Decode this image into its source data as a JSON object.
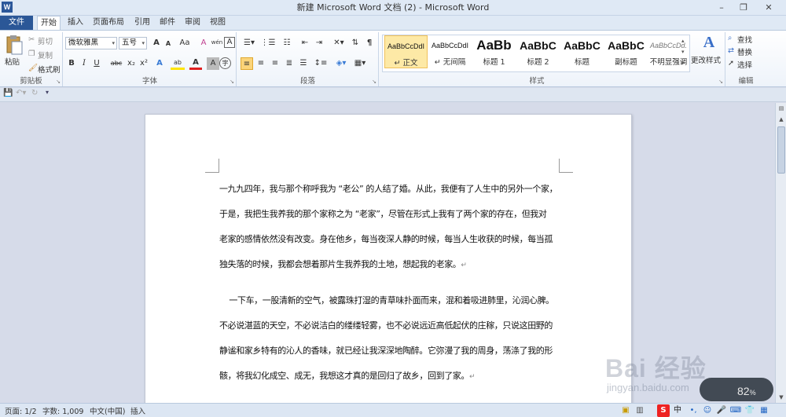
{
  "titlebar": {
    "app_icon": "W",
    "title": "新建 Microsoft Word 文档 (2) - Microsoft Word",
    "minimize": "–",
    "maximize": "❐",
    "close": "✕"
  },
  "tabs": [
    "文件",
    "开始",
    "插入",
    "页面布局",
    "引用",
    "邮件",
    "审阅",
    "视图"
  ],
  "ribbon_right": "▵ ?",
  "clipboard": {
    "label": "剪贴板",
    "paste": "粘贴",
    "cut": "剪切",
    "copy": "复制",
    "format_painter": "格式刷"
  },
  "font": {
    "label": "字体",
    "family": "微软雅黑",
    "size": "五号",
    "grow": "A",
    "shrink": "A",
    "case": "Aa",
    "clear": "A",
    "phonetic": "wén",
    "border": "A",
    "bold": "B",
    "italic": "I",
    "underline": "U",
    "strike": "abc",
    "subscript": "x₂",
    "superscript": "x²",
    "effects": "A",
    "highlight": "ab",
    "color": "A",
    "shading": "A",
    "enclose": "字"
  },
  "paragraph": {
    "label": "段落"
  },
  "styles": {
    "label": "样式",
    "items": [
      {
        "preview": "AaBbCcDdI",
        "name": "↵ 正文"
      },
      {
        "preview": "AaBbCcDdI",
        "name": "↵ 无间隔"
      },
      {
        "preview": "AaBb",
        "name": "标题 1"
      },
      {
        "preview": "AaBbC",
        "name": "标题 2"
      },
      {
        "preview": "AaBbC",
        "name": "标题"
      },
      {
        "preview": "AaBbC",
        "name": "副标题"
      },
      {
        "preview": "AaBbCcDd.",
        "name": "不明显强调"
      }
    ],
    "change_styles": "更改样式"
  },
  "editing": {
    "label": "编辑",
    "find": "查找",
    "replace": "替换",
    "select": "选择"
  },
  "document": {
    "paragraphs": [
      {
        "lines": [
          "一九九四年，我与那个称呼我为 “老公” 的人结了婚。从此，我便有了人生中的另外一个家，",
          "于是，我把生我养我的那个家称之为 “老家”，尽管在形式上我有了两个家的存在，但我对",
          "老家的感情依然没有改变。身在他乡，每当夜深人静的时候，每当人生收获的时候，每当孤",
          "独失落的时候，我都会想着那片生我养我的土地，想起我的老家。"
        ]
      },
      {
        "lines": [
          "    一下车，一股清新的空气，被露珠打湿的青草味扑面而来，混和着吸进肺里，沁润心脾。",
          "不必说湛蓝的天空，不必说洁白的缕缕轻雾，也不必说远近高低起伏的庄稼，只说这田野的",
          "静谧和家乡特有的沁人的香味，就已经让我深深地陶醉。它弥漫了我的周身，荡涤了我的形",
          "骸，将我幻化成空、成无，我想这才真的是回归了故乡，回到了家。"
        ]
      }
    ],
    "para_mark": "↵"
  },
  "statusbar": {
    "page": "页面: 1/2",
    "words": "字数: 1,009",
    "language": "中文(中国)",
    "mode": "插入"
  },
  "tray": {
    "ime": "中",
    "zoom": "82",
    "zoom_unit": "%"
  },
  "watermark": {
    "text": "Bai 经验",
    "url": "jingyan.baidu.com"
  }
}
